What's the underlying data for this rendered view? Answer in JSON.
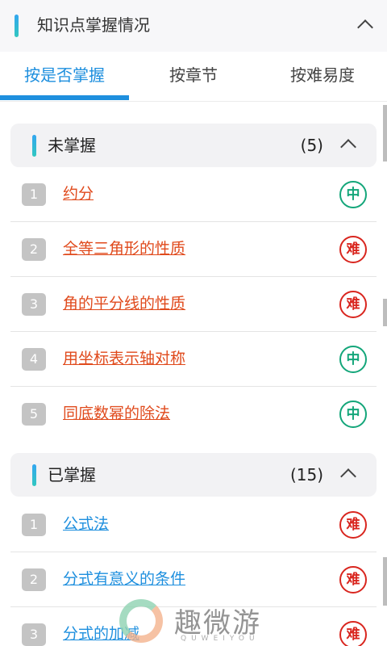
{
  "header": {
    "title": "知识点掌握情况"
  },
  "tabs": [
    {
      "label": "按是否掌握",
      "active": true
    },
    {
      "label": "按章节",
      "active": false
    },
    {
      "label": "按难易度",
      "active": false
    }
  ],
  "sections": [
    {
      "title": "未掌握",
      "count": "(5)",
      "items": [
        {
          "num": "1",
          "topic": "约分",
          "difficulty": "中"
        },
        {
          "num": "2",
          "topic": "全等三角形的性质",
          "difficulty": "难"
        },
        {
          "num": "3",
          "topic": "角的平分线的性质",
          "difficulty": "难"
        },
        {
          "num": "4",
          "topic": "用坐标表示轴对称",
          "difficulty": "中"
        },
        {
          "num": "5",
          "topic": "同底数幂的除法",
          "difficulty": "中"
        }
      ]
    },
    {
      "title": "已掌握",
      "count": "(15)",
      "items": [
        {
          "num": "1",
          "topic": "公式法",
          "difficulty": "难"
        },
        {
          "num": "2",
          "topic": "分式有意义的条件",
          "difficulty": "难"
        },
        {
          "num": "3",
          "topic": "分式的加减",
          "difficulty": "难"
        }
      ]
    }
  ],
  "watermark": {
    "text": "趣微游",
    "sub": "QUWEIYOU"
  },
  "colors": {
    "accent": "#1e8fde",
    "unmastered_topic": "#e04a1c",
    "mastered_topic": "#1e8fde",
    "medium_badge": "#14a67a",
    "hard_badge": "#d9261f"
  }
}
